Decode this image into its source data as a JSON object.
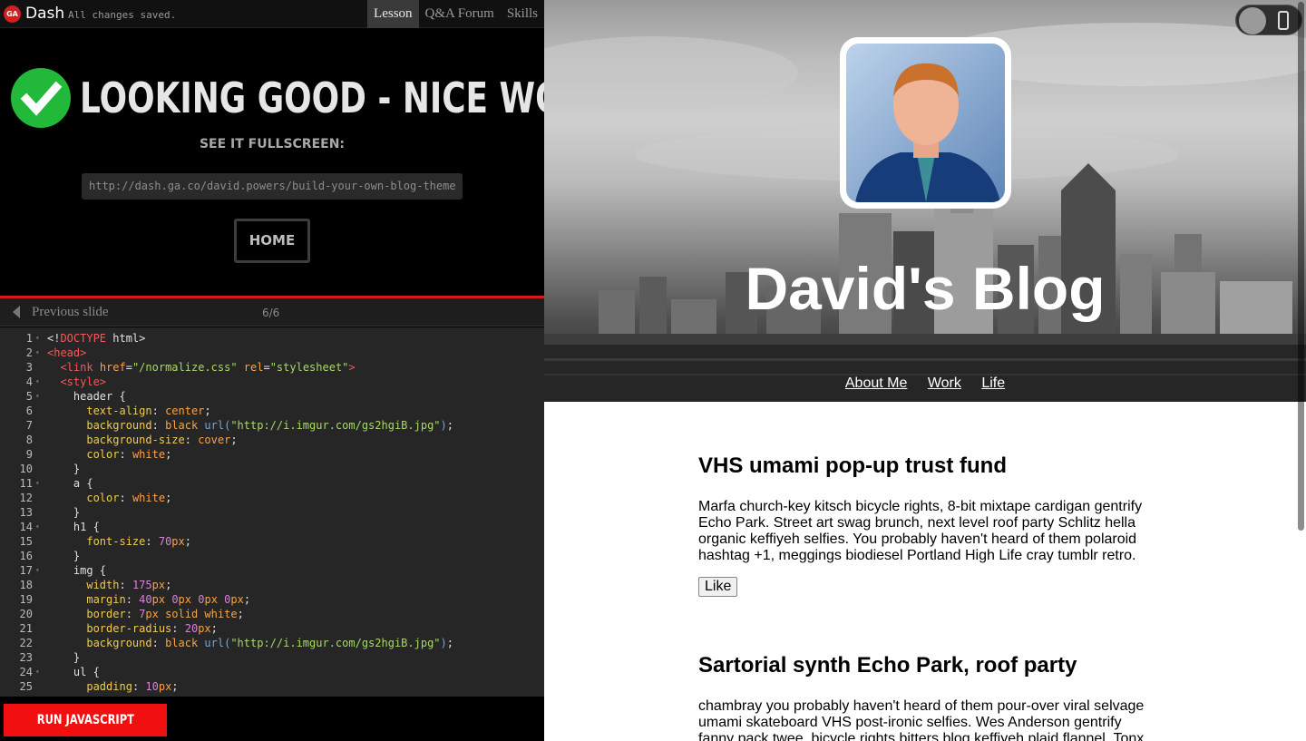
{
  "topbar": {
    "logo_text": "GA",
    "app_name": "Dash",
    "save_status": "All changes saved.",
    "tabs": [
      {
        "label": "Lesson",
        "active": true
      },
      {
        "label": "Q&A Forum",
        "active": false
      },
      {
        "label": "Skills",
        "active": false
      }
    ]
  },
  "success": {
    "title": "LOOKING GOOD - NICE WORK!",
    "fullscreen_label": "SEE IT FULLSCREEN:",
    "url": "http://dash.ga.co/david.powers/build-your-own-blog-theme",
    "home_label": "HOME",
    "check_color": "#22b83a"
  },
  "slide_nav": {
    "prev_label": "Previous slide",
    "count": "6/6"
  },
  "editor": {
    "lines": [
      {
        "n": "1",
        "fold": true
      },
      {
        "n": "2",
        "fold": true
      },
      {
        "n": "3",
        "fold": false
      },
      {
        "n": "4",
        "fold": true
      },
      {
        "n": "5",
        "fold": true
      },
      {
        "n": "6",
        "fold": false
      },
      {
        "n": "7",
        "fold": false
      },
      {
        "n": "8",
        "fold": false
      },
      {
        "n": "9",
        "fold": false
      },
      {
        "n": "10",
        "fold": false
      },
      {
        "n": "11",
        "fold": true
      },
      {
        "n": "12",
        "fold": false
      },
      {
        "n": "13",
        "fold": false
      },
      {
        "n": "14",
        "fold": true
      },
      {
        "n": "15",
        "fold": false
      },
      {
        "n": "16",
        "fold": false
      },
      {
        "n": "17",
        "fold": true
      },
      {
        "n": "18",
        "fold": false
      },
      {
        "n": "19",
        "fold": false
      },
      {
        "n": "20",
        "fold": false
      },
      {
        "n": "21",
        "fold": false
      },
      {
        "n": "22",
        "fold": false
      },
      {
        "n": "23",
        "fold": false
      },
      {
        "n": "24",
        "fold": true
      },
      {
        "n": "25",
        "fold": false
      }
    ],
    "code": [
      [
        [
          "p",
          "<!"
        ],
        [
          "tag",
          "DOCTYPE"
        ],
        [
          "p",
          " html>"
        ]
      ],
      [
        [
          "tag",
          "<head>"
        ]
      ],
      [
        [
          "p",
          "  "
        ],
        [
          "tag",
          "<link"
        ],
        [
          "p",
          " "
        ],
        [
          "attr",
          "href"
        ],
        [
          "p",
          "="
        ],
        [
          "str",
          "\"/normalize.css\""
        ],
        [
          "p",
          " "
        ],
        [
          "attr",
          "rel"
        ],
        [
          "p",
          "="
        ],
        [
          "str",
          "\"stylesheet\""
        ],
        [
          "tag",
          ">"
        ]
      ],
      [
        [
          "p",
          "  "
        ],
        [
          "tag",
          "<style>"
        ]
      ],
      [
        [
          "p",
          "    header {"
        ]
      ],
      [
        [
          "p",
          "      "
        ],
        [
          "prop",
          "text-align"
        ],
        [
          "p",
          ": "
        ],
        [
          "val",
          "center"
        ],
        [
          "p",
          ";"
        ]
      ],
      [
        [
          "p",
          "      "
        ],
        [
          "prop",
          "background"
        ],
        [
          "p",
          ": "
        ],
        [
          "val",
          "black"
        ],
        [
          "p",
          " "
        ],
        [
          "fn",
          "url("
        ],
        [
          "str",
          "\"http://i.imgur.com/gs2hgiB.jpg\""
        ],
        [
          "fn",
          ")"
        ],
        [
          "p",
          ";"
        ]
      ],
      [
        [
          "p",
          "      "
        ],
        [
          "prop",
          "background-size"
        ],
        [
          "p",
          ": "
        ],
        [
          "val",
          "cover"
        ],
        [
          "p",
          ";"
        ]
      ],
      [
        [
          "p",
          "      "
        ],
        [
          "prop",
          "color"
        ],
        [
          "p",
          ": "
        ],
        [
          "val",
          "white"
        ],
        [
          "p",
          ";"
        ]
      ],
      [
        [
          "p",
          "    }"
        ]
      ],
      [
        [
          "p",
          "    a {"
        ]
      ],
      [
        [
          "p",
          "      "
        ],
        [
          "prop",
          "color"
        ],
        [
          "p",
          ": "
        ],
        [
          "val",
          "white"
        ],
        [
          "p",
          ";"
        ]
      ],
      [
        [
          "p",
          "    }"
        ]
      ],
      [
        [
          "p",
          "    h1 {"
        ]
      ],
      [
        [
          "p",
          "      "
        ],
        [
          "prop",
          "font-size"
        ],
        [
          "p",
          ": "
        ],
        [
          "num",
          "70"
        ],
        [
          "val",
          "px"
        ],
        [
          "p",
          ";"
        ]
      ],
      [
        [
          "p",
          "    }"
        ]
      ],
      [
        [
          "p",
          "    img {"
        ]
      ],
      [
        [
          "p",
          "      "
        ],
        [
          "prop",
          "width"
        ],
        [
          "p",
          ": "
        ],
        [
          "num",
          "175"
        ],
        [
          "val",
          "px"
        ],
        [
          "p",
          ";"
        ]
      ],
      [
        [
          "p",
          "      "
        ],
        [
          "prop",
          "margin"
        ],
        [
          "p",
          ": "
        ],
        [
          "num",
          "40"
        ],
        [
          "val",
          "px "
        ],
        [
          "num",
          "0"
        ],
        [
          "val",
          "px "
        ],
        [
          "num",
          "0"
        ],
        [
          "val",
          "px "
        ],
        [
          "num",
          "0"
        ],
        [
          "val",
          "px"
        ],
        [
          "p",
          ";"
        ]
      ],
      [
        [
          "p",
          "      "
        ],
        [
          "prop",
          "border"
        ],
        [
          "p",
          ": "
        ],
        [
          "num",
          "7"
        ],
        [
          "val",
          "px solid white"
        ],
        [
          "p",
          ";"
        ]
      ],
      [
        [
          "p",
          "      "
        ],
        [
          "prop",
          "border-radius"
        ],
        [
          "p",
          ": "
        ],
        [
          "num",
          "20"
        ],
        [
          "val",
          "px"
        ],
        [
          "p",
          ";"
        ]
      ],
      [
        [
          "p",
          "      "
        ],
        [
          "prop",
          "background"
        ],
        [
          "p",
          ": "
        ],
        [
          "val",
          "black"
        ],
        [
          "p",
          " "
        ],
        [
          "fn",
          "url("
        ],
        [
          "str",
          "\"http://i.imgur.com/gs2hgiB.jpg\""
        ],
        [
          "fn",
          ")"
        ],
        [
          "p",
          ";"
        ]
      ],
      [
        [
          "p",
          "    }"
        ]
      ],
      [
        [
          "p",
          "    ul {"
        ]
      ],
      [
        [
          "p",
          "      "
        ],
        [
          "prop",
          "padding"
        ],
        [
          "p",
          ": "
        ],
        [
          "num",
          "10"
        ],
        [
          "val",
          "px"
        ],
        [
          "p",
          ";"
        ]
      ]
    ]
  },
  "run_button": {
    "label": "RUN JAVASCRIPT",
    "color": "#f20f0f"
  },
  "preview": {
    "blog_title": "David's Blog",
    "nav": [
      "About Me",
      "Work",
      "Life"
    ],
    "posts": [
      {
        "title": "VHS umami pop-up trust fund",
        "body": "Marfa church-key kitsch bicycle rights, 8-bit mixtape cardigan gentrify Echo Park. Street art swag brunch, next level roof party Schlitz hella organic keffiyeh selfies. You probably haven't heard of them polaroid hashtag +1, meggings biodiesel Portland High Life cray tumblr retro.",
        "like_label": "Like"
      },
      {
        "title": "Sartorial synth Echo Park, roof party",
        "body": "chambray you probably haven't heard of them pour-over viral selvage umami skateboard VHS post-ironic selfies. Wes Anderson gentrify fanny pack twee, bicycle rights bitters blog keffiyeh plaid flannel. Tonx",
        "like_label": ""
      }
    ]
  }
}
